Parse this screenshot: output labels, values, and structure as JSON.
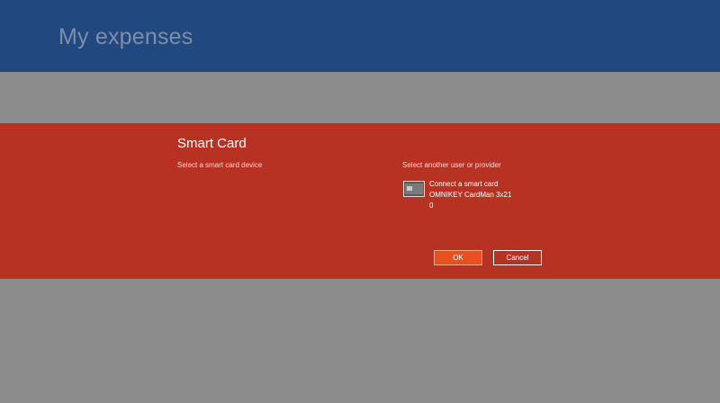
{
  "app": {
    "title": "My expenses"
  },
  "dialog": {
    "title": "Smart Card",
    "subtitle": "Select a smart card device",
    "alt_link": "Select another user or provider",
    "card_option": {
      "line1": "Connect a smart card",
      "line2": "OMNIKEY CardMan 3x21",
      "line3": "0",
      "icon": "smart-card-reader-icon"
    },
    "buttons": {
      "ok": "OK",
      "cancel": "Cancel"
    }
  },
  "colors": {
    "header": "#22497f",
    "dialog": "#b83223",
    "ok_button": "#e8501f",
    "background": "#8c8c8c"
  }
}
